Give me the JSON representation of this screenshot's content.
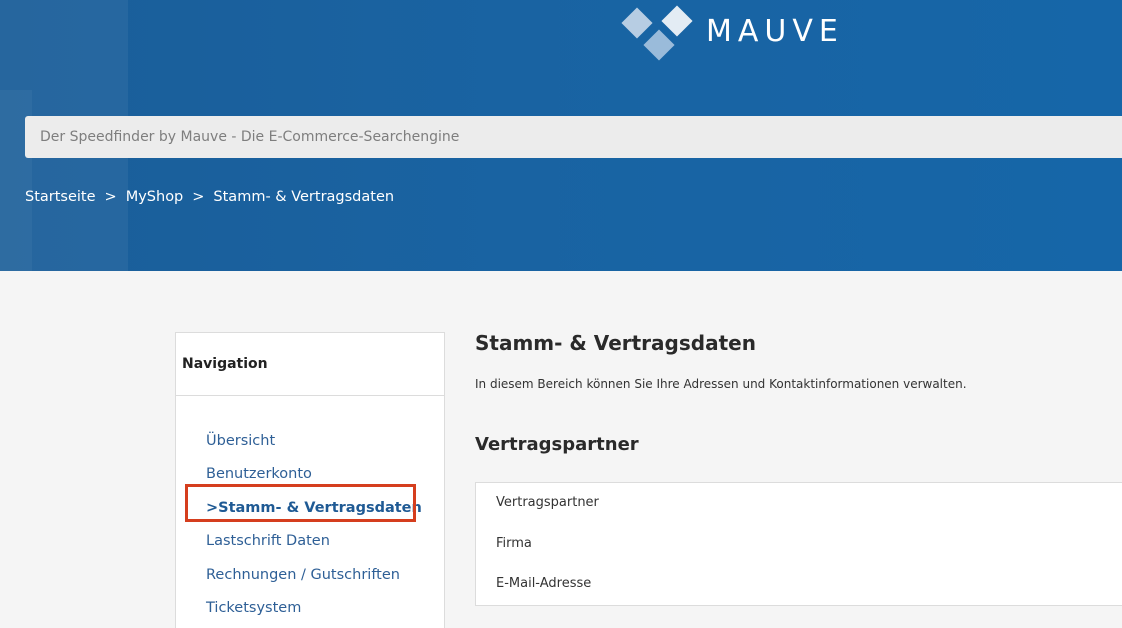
{
  "brand": {
    "logo_text": "MAUVE"
  },
  "search": {
    "placeholder": "Der Speedfinder by Mauve - Die E-Commerce-Searchengine"
  },
  "breadcrumb": {
    "items": [
      "Startseite",
      "MyShop",
      "Stamm- & Vertragsdaten"
    ],
    "separator": ">"
  },
  "sidebar": {
    "title": "Navigation",
    "items": [
      {
        "label": "Übersicht"
      },
      {
        "label": "Benutzerkonto"
      },
      {
        "label": ">Stamm- & Vertragsdaten",
        "active": true
      },
      {
        "label": "Lastschrift Daten"
      },
      {
        "label": "Rechnungen / Gutschriften"
      },
      {
        "label": "Ticketsystem"
      }
    ]
  },
  "main": {
    "title": "Stamm- & Vertragsdaten",
    "description": "In diesem Bereich können Sie Ihre Adressen und Kontaktinformationen verwalten.",
    "section_title": "Vertragspartner",
    "fields": [
      "Vertragspartner",
      "Firma",
      "E-Mail-Adresse"
    ]
  },
  "colors": {
    "header_blue": "#1963a2",
    "link_blue": "#2e5f96",
    "highlight_red": "#d53e1e"
  }
}
